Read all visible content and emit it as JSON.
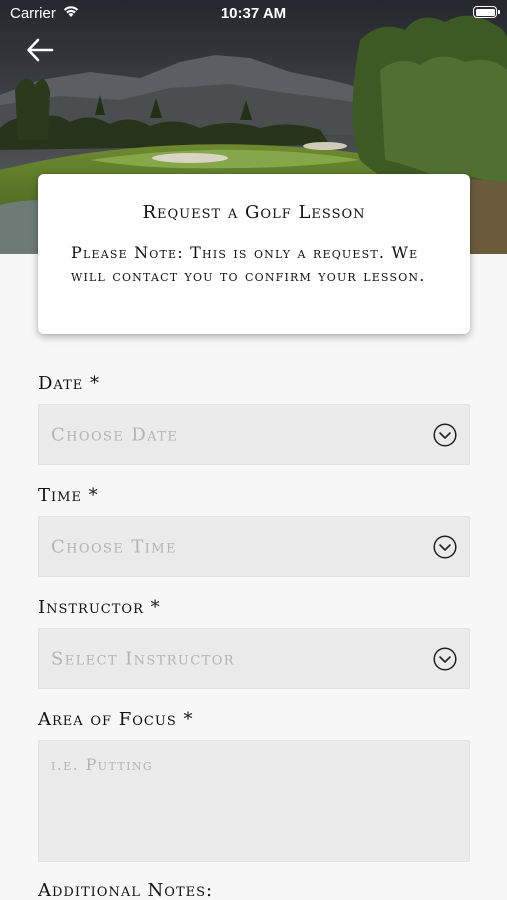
{
  "status_bar": {
    "carrier": "Carrier",
    "time": "10:37 AM"
  },
  "header": {
    "back_icon": "arrow-left-icon",
    "hero_image": "golf-course-mountain-landscape"
  },
  "card": {
    "title": "Request a Golf Lesson",
    "note": "Please Note: This is only a request. We will contact you to confirm your lesson."
  },
  "form": {
    "date": {
      "label": "Date *",
      "placeholder": "Choose Date",
      "icon": "chevron-down-circle-icon"
    },
    "time": {
      "label": "Time *",
      "placeholder": "Choose Time",
      "icon": "chevron-down-circle-icon"
    },
    "instructor": {
      "label": "Instructor *",
      "placeholder": "Select Instructor",
      "icon": "chevron-down-circle-icon"
    },
    "focus": {
      "label": "Area of Focus *",
      "placeholder": "i.e. Putting"
    },
    "notes": {
      "label": "Additional Notes:"
    }
  },
  "colors": {
    "background": "#f7f7f7",
    "field_background": "#ebebeb",
    "placeholder_text": "#b3b3b3",
    "text": "#111111"
  }
}
